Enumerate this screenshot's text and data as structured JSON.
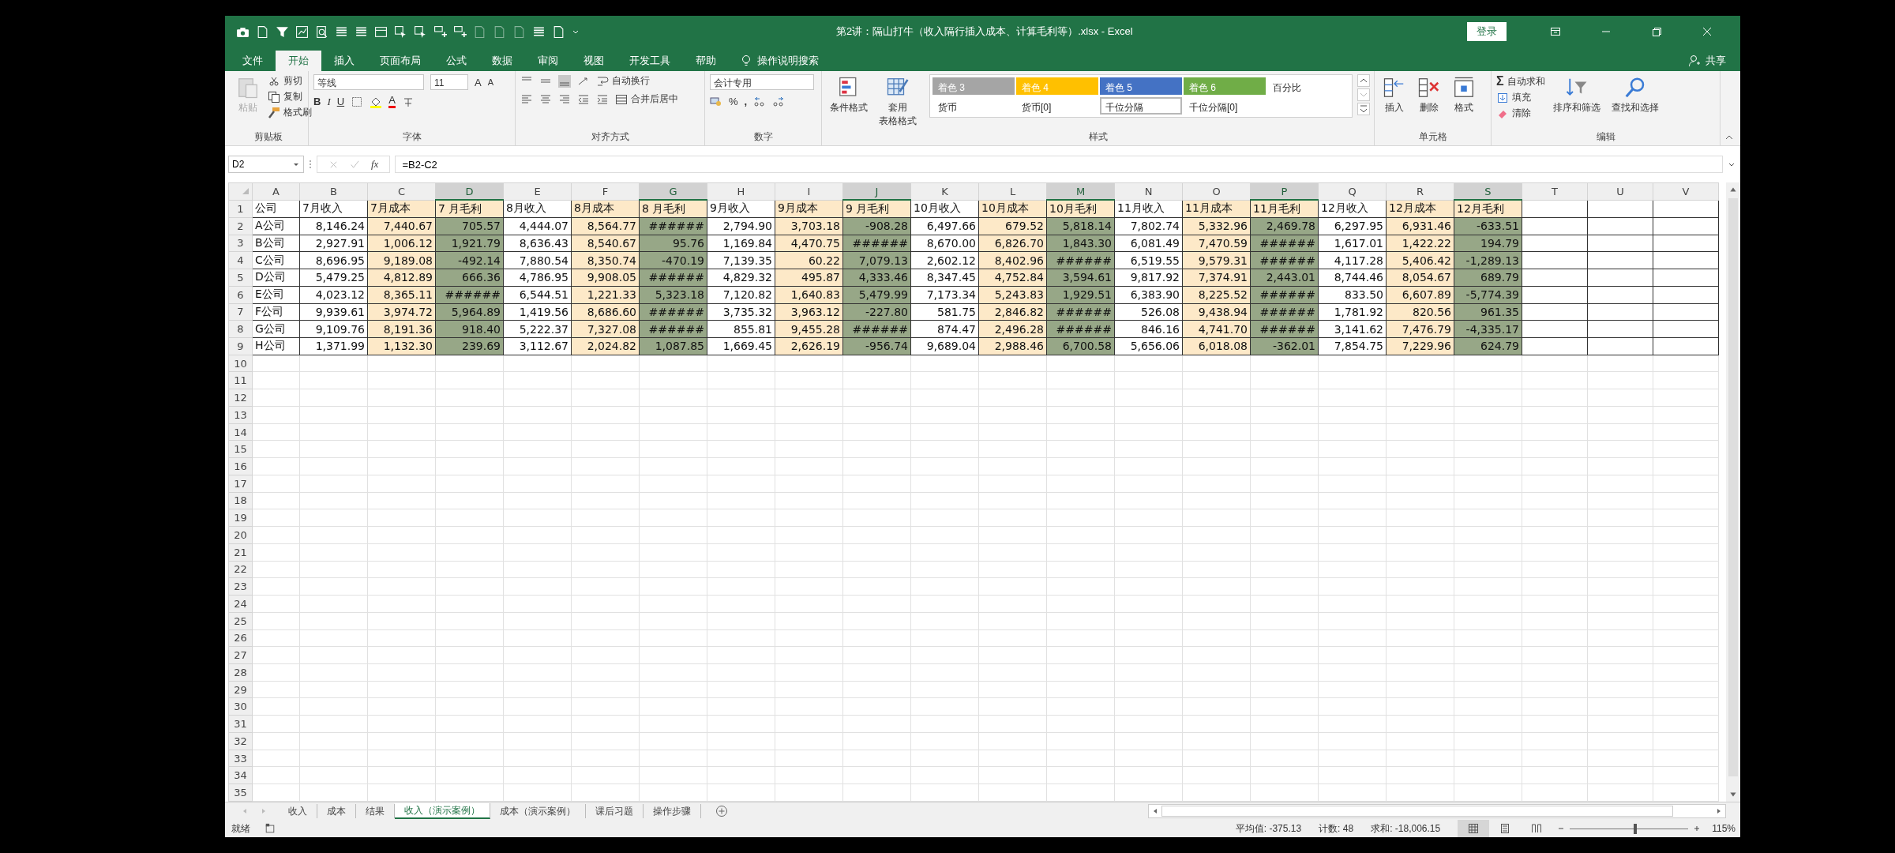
{
  "window": {
    "title": "第2讲：隔山打牛（收入隔行插入成本、计算毛利等）.xlsx  -  Excel",
    "login_button": "登录"
  },
  "ribbon_tabs": [
    {
      "label": "文件",
      "selected": false
    },
    {
      "label": "开始",
      "selected": true
    },
    {
      "label": "插入",
      "selected": false
    },
    {
      "label": "页面布局",
      "selected": false
    },
    {
      "label": "公式",
      "selected": false
    },
    {
      "label": "数据",
      "selected": false
    },
    {
      "label": "审阅",
      "selected": false
    },
    {
      "label": "视图",
      "selected": false
    },
    {
      "label": "开发工具",
      "selected": false
    },
    {
      "label": "帮助",
      "selected": false
    }
  ],
  "tell_me": "操作说明搜索",
  "share": "共享",
  "clipboard": {
    "paste": "粘贴",
    "cut": "剪切",
    "copy": "复制",
    "format_painter": "格式刷",
    "label": "剪贴板"
  },
  "font": {
    "name": "等线",
    "size": "11",
    "bold": "B",
    "italic": "I",
    "underline": "U",
    "grow": "A",
    "shrink": "A",
    "color_button": "A",
    "label": "字体"
  },
  "alignment": {
    "wrap": "自动换行",
    "merge": "合并后居中",
    "label": "对齐方式"
  },
  "number": {
    "format": "会计专用",
    "percent": "%",
    "comma": ",",
    "label": "数字"
  },
  "styles": {
    "conditional": "条件格式",
    "table_format_1": "套用",
    "table_format_2": "表格格式",
    "label": "样式",
    "cell_styles": [
      {
        "label": "着色 3",
        "color": "#a5a5a5",
        "selected": false
      },
      {
        "label": "着色 4",
        "color": "#ffc000",
        "selected": false
      },
      {
        "label": "着色 5",
        "color": "#4472c4",
        "selected": false
      },
      {
        "label": "着色 6",
        "color": "#70ad47",
        "selected": false
      },
      {
        "label": "百分比",
        "selected": false
      },
      {
        "label": "货币",
        "selected": false
      },
      {
        "label": "货币[0]",
        "selected": false
      },
      {
        "label": "千位分隔",
        "selected": true
      },
      {
        "label": "千位分隔[0]",
        "selected": false
      }
    ]
  },
  "cells_group": {
    "insert": "插入",
    "delete": "删除",
    "format": "格式",
    "label": "单元格"
  },
  "editing": {
    "sigma": "Σ",
    "autosum": "自动求和",
    "fill": "填充",
    "clear": "清除",
    "sort": "排序和筛选",
    "find": "查找和选择",
    "label": "编辑"
  },
  "name_box": "D2",
  "fx": "fx",
  "formula": "=B2-C2",
  "columns": [
    {
      "letter": "A",
      "kind": "label",
      "selected": false
    },
    {
      "letter": "B",
      "kind": "income",
      "selected": false
    },
    {
      "letter": "C",
      "kind": "cost",
      "selected": false
    },
    {
      "letter": "D",
      "kind": "profit",
      "selected": true
    },
    {
      "letter": "E",
      "kind": "income",
      "selected": false
    },
    {
      "letter": "F",
      "kind": "cost",
      "selected": false
    },
    {
      "letter": "G",
      "kind": "profit",
      "selected": true
    },
    {
      "letter": "H",
      "kind": "income",
      "selected": false
    },
    {
      "letter": "I",
      "kind": "cost",
      "selected": false
    },
    {
      "letter": "J",
      "kind": "profit",
      "selected": true
    },
    {
      "letter": "K",
      "kind": "income",
      "selected": false
    },
    {
      "letter": "L",
      "kind": "cost",
      "selected": false
    },
    {
      "letter": "M",
      "kind": "profit",
      "selected": true
    },
    {
      "letter": "N",
      "kind": "income",
      "selected": false
    },
    {
      "letter": "O",
      "kind": "cost",
      "selected": false
    },
    {
      "letter": "P",
      "kind": "profit",
      "selected": true
    },
    {
      "letter": "Q",
      "kind": "income",
      "selected": false
    },
    {
      "letter": "R",
      "kind": "cost",
      "selected": false
    },
    {
      "letter": "S",
      "kind": "profit",
      "selected": true
    },
    {
      "letter": "T",
      "kind": "empty",
      "selected": false
    },
    {
      "letter": "U",
      "kind": "empty",
      "selected": false
    },
    {
      "letter": "V",
      "kind": "empty",
      "selected": false
    }
  ],
  "row_numbers": [
    "1",
    "2",
    "3",
    "4",
    "5",
    "6",
    "7",
    "8",
    "9",
    "10",
    "11",
    "12",
    "13",
    "14",
    "15",
    "16",
    "17",
    "18",
    "19",
    "20",
    "21",
    "22",
    "23",
    "24",
    "25",
    "26",
    "27",
    "28",
    "29",
    "30",
    "31",
    "32",
    "33",
    "34",
    "35"
  ],
  "rows": [
    [
      "公司",
      "7月收入",
      "7月成本",
      "7 月毛利",
      "8月收入",
      "8月成本",
      "8 月毛利",
      "9月收入",
      "9月成本",
      "9 月毛利",
      "10月收入",
      "10月成本",
      "10月毛利",
      "11月收入",
      "11月成本",
      "11月毛利",
      "12月收入",
      "12月成本",
      "12月毛利"
    ],
    [
      "A公司",
      "8,146.24",
      "7,440.67",
      "705.57",
      "4,444.07",
      "8,564.77",
      "######",
      "2,794.90",
      "3,703.18",
      "-908.28",
      "6,497.66",
      "679.52",
      "5,818.14",
      "7,802.74",
      "5,332.96",
      "2,469.78",
      "6,297.95",
      "6,931.46",
      "-633.51"
    ],
    [
      "B公司",
      "2,927.91",
      "1,006.12",
      "1,921.79",
      "8,636.43",
      "8,540.67",
      "95.76",
      "1,169.84",
      "4,470.75",
      "######",
      "8,670.00",
      "6,826.70",
      "1,843.30",
      "6,081.49",
      "7,470.59",
      "######",
      "1,617.01",
      "1,422.22",
      "194.79"
    ],
    [
      "C公司",
      "8,696.95",
      "9,189.08",
      "-492.14",
      "7,880.54",
      "8,350.74",
      "-470.19",
      "7,139.35",
      "60.22",
      "7,079.13",
      "2,602.12",
      "8,402.96",
      "######",
      "6,519.55",
      "9,579.31",
      "######",
      "4,117.28",
      "5,406.42",
      "-1,289.13"
    ],
    [
      "D公司",
      "5,479.25",
      "4,812.89",
      "666.36",
      "4,786.95",
      "9,908.05",
      "######",
      "4,829.32",
      "495.87",
      "4,333.46",
      "8,347.45",
      "4,752.84",
      "3,594.61",
      "9,817.92",
      "7,374.91",
      "2,443.01",
      "8,744.46",
      "8,054.67",
      "689.79"
    ],
    [
      "E公司",
      "4,023.12",
      "8,365.11",
      "######",
      "6,544.51",
      "1,221.33",
      "5,323.18",
      "7,120.82",
      "1,640.83",
      "5,479.99",
      "7,173.34",
      "5,243.83",
      "1,929.51",
      "6,383.90",
      "8,225.52",
      "######",
      "833.50",
      "6,607.89",
      "-5,774.39"
    ],
    [
      "F公司",
      "9,939.61",
      "3,974.72",
      "5,964.89",
      "1,419.56",
      "8,686.60",
      "######",
      "3,735.32",
      "3,963.12",
      "-227.80",
      "581.75",
      "2,846.82",
      "######",
      "526.08",
      "9,438.94",
      "######",
      "1,781.92",
      "820.56",
      "961.35"
    ],
    [
      "G公司",
      "9,109.76",
      "8,191.36",
      "918.40",
      "5,222.37",
      "7,327.08",
      "######",
      "855.81",
      "9,455.28",
      "######",
      "874.47",
      "2,496.28",
      "######",
      "846.16",
      "4,741.70",
      "######",
      "3,141.62",
      "7,476.79",
      "-4,335.17"
    ],
    [
      "H公司",
      "1,371.99",
      "1,132.30",
      "239.69",
      "3,112.67",
      "2,024.82",
      "1,087.85",
      "1,669.45",
      "2,626.19",
      "-956.74",
      "9,689.04",
      "2,988.46",
      "6,700.58",
      "5,656.06",
      "6,018.08",
      "-362.01",
      "7,854.75",
      "7,229.96",
      "624.79"
    ]
  ],
  "sheet_tabs": [
    {
      "label": "收入",
      "selected": false
    },
    {
      "label": "成本",
      "selected": false
    },
    {
      "label": "结果",
      "selected": false
    },
    {
      "label": "收入（演示案例）",
      "selected": true
    },
    {
      "label": "成本（演示案例）",
      "selected": false
    },
    {
      "label": "课后习题",
      "selected": false
    },
    {
      "label": "操作步骤",
      "selected": false
    }
  ],
  "status_bar": {
    "ready": "就绪",
    "average": "平均值: -375.13",
    "count": "计数: 48",
    "sum": "求和: -18,006.15",
    "zoom": "115%",
    "zoom_slider": {
      "level": 0.55
    }
  }
}
